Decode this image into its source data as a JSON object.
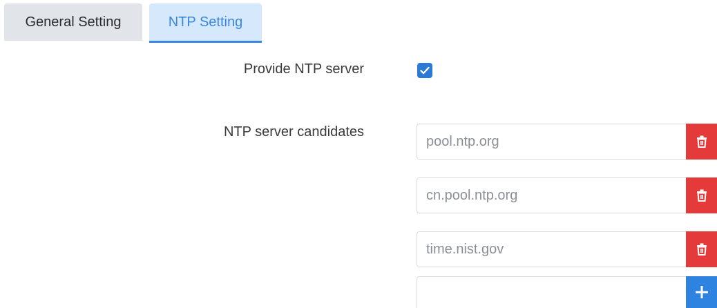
{
  "tabs": [
    {
      "label": "General Setting",
      "active": false
    },
    {
      "label": "NTP Setting",
      "active": true
    }
  ],
  "form": {
    "provide_ntp_label": "Provide NTP server",
    "provide_ntp_checked": true,
    "candidates_label": "NTP server candidates",
    "candidates": [
      {
        "value": "pool.ntp.org",
        "action": "delete",
        "icon": "trash-icon"
      },
      {
        "value": "cn.pool.ntp.org",
        "action": "delete",
        "icon": "trash-icon"
      },
      {
        "value": "time.nist.gov",
        "action": "delete",
        "icon": "trash-icon"
      },
      {
        "value": "",
        "action": "add",
        "icon": "plus-icon"
      }
    ]
  },
  "colors": {
    "accent": "#2e83e0",
    "danger": "#e53a3a",
    "active_tab_bg": "#d6e8fb",
    "inactive_tab_bg": "#e1e4e8"
  }
}
